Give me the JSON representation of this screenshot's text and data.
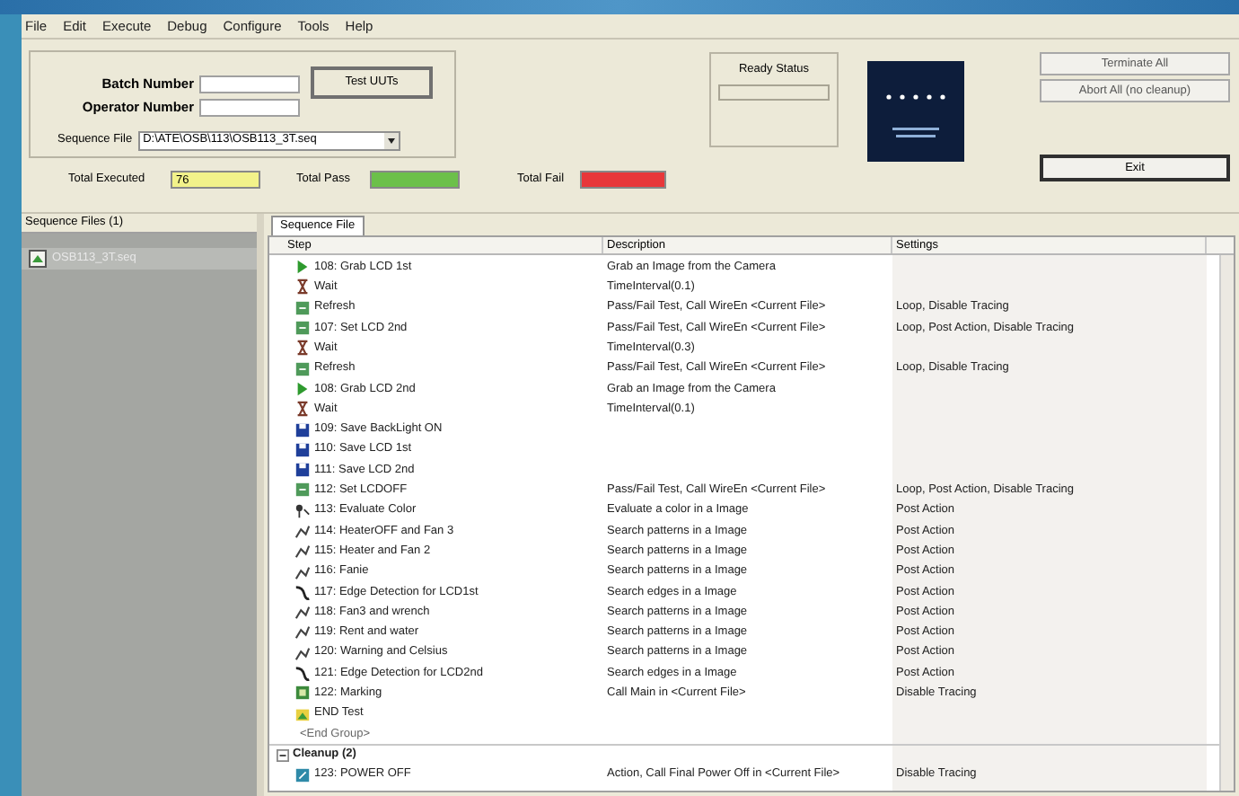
{
  "menu": [
    "File",
    "Edit",
    "Execute",
    "Debug",
    "Configure",
    "Tools",
    "Help"
  ],
  "operator_panel": {
    "batch_label": "Batch Number",
    "operator_label": "Operator Number",
    "test_button": "Test UUTs",
    "sequence_label": "Sequence File",
    "sequence_value": "D:\\ATE\\OSB\\113\\OSB113_3T.seq"
  },
  "status_panel": {
    "title": "Ready Status"
  },
  "buttons": [
    {
      "label": "Terminate All",
      "kind": "normal"
    },
    {
      "label": "Abort All (no cleanup)",
      "kind": "normal"
    },
    {
      "label": "Exit",
      "kind": "default"
    }
  ],
  "counters": [
    {
      "label": "Total Executed",
      "value": "76",
      "color": "#f2f28a"
    },
    {
      "label": "Total Pass",
      "color": "#6cc04a"
    },
    {
      "label": "Total Fail",
      "color": "#e8373a"
    }
  ],
  "sequence_files": {
    "title": "Sequence Files (1)",
    "items": [
      {
        "name": "OSB113_3T.seq",
        "selected": true
      }
    ]
  },
  "tabs": [
    {
      "label": "Sequence File",
      "selected": true
    }
  ],
  "table": {
    "columns": [
      "Step",
      "Description",
      "Settings"
    ],
    "rows": [
      {
        "kind": "grab",
        "step": "108: Grab LCD 1st",
        "description": "Grab an Image from the Camera"
      },
      {
        "kind": "wait",
        "step": "Wait",
        "description": "TimeInterval(0.1)"
      },
      {
        "kind": "refresh",
        "step": "Refresh",
        "description": "Pass/Fail Test, Call WireEn <Current File>",
        "settings": "Loop, Disable Tracing"
      },
      {
        "kind": "refresh",
        "step": "107: Set LCD 2nd",
        "description": "Pass/Fail Test, Call WireEn <Current File>",
        "settings": "Loop, Post Action, Disable Tracing"
      },
      {
        "kind": "wait",
        "step": "Wait",
        "description": "TimeInterval(0.3)"
      },
      {
        "kind": "refresh",
        "step": "Refresh",
        "description": "Pass/Fail Test, Call WireEn <Current File>",
        "settings": "Loop, Disable Tracing"
      },
      {
        "kind": "grab",
        "step": "108: Grab LCD 2nd",
        "description": "Grab an Image from the Camera"
      },
      {
        "kind": "wait",
        "step": "Wait",
        "description": "TimeInterval(0.1)"
      },
      {
        "kind": "save",
        "step": "109: Save BackLight ON"
      },
      {
        "kind": "save",
        "step": "110: Save LCD 1st"
      },
      {
        "kind": "save",
        "step": "111: Save LCD 2nd"
      },
      {
        "kind": "refresh",
        "step": "112: Set LCDOFF",
        "description": "Pass/Fail Test, Call WireEn <Current File>",
        "settings": "Loop, Post Action, Disable Tracing"
      },
      {
        "kind": "color",
        "step": "113: Evaluate Color",
        "description": "Evaluate a color in a Image",
        "settings": "Post Action"
      },
      {
        "kind": "pattern",
        "step": "114: HeaterOFF and Fan 3",
        "description": "Search patterns in a Image",
        "settings": "Post Action"
      },
      {
        "kind": "pattern",
        "step": "115: Heater and Fan 2",
        "description": "Search patterns in a Image",
        "settings": "Post Action"
      },
      {
        "kind": "pattern",
        "step": "116: Fanie",
        "description": "Search patterns in a Image",
        "settings": "Post Action"
      },
      {
        "kind": "edge",
        "step": "117: Edge Detection for LCD1st",
        "description": "Search edges in a Image",
        "settings": "Post Action"
      },
      {
        "kind": "pattern",
        "step": "118: Fan3 and wrench",
        "description": "Search patterns in a Image",
        "settings": "Post Action"
      },
      {
        "kind": "pattern",
        "step": "119: Rent and water",
        "description": "Search patterns in a Image",
        "settings": "Post Action"
      },
      {
        "kind": "pattern",
        "step": "120: Warning and Celsius",
        "description": "Search patterns in a Image",
        "settings": "Post Action"
      },
      {
        "kind": "edge",
        "step": "121: Edge Detection for LCD2nd",
        "description": "Search edges in a Image",
        "settings": "Post Action"
      },
      {
        "kind": "call",
        "step": "122: Marking",
        "description": "Call Main in <Current File>",
        "settings": "Disable Tracing"
      },
      {
        "kind": "label",
        "step": "END Test"
      },
      {
        "kind": "end",
        "step": "<End Group>"
      },
      {
        "kind": "group",
        "step": "Cleanup (2)",
        "expanded": true,
        "children": [
          {
            "kind": "action",
            "step": "123: POWER OFF",
            "description": "Action, Call Final Power Off in <Current File>",
            "settings": "Disable Tracing"
          }
        ]
      }
    ]
  }
}
